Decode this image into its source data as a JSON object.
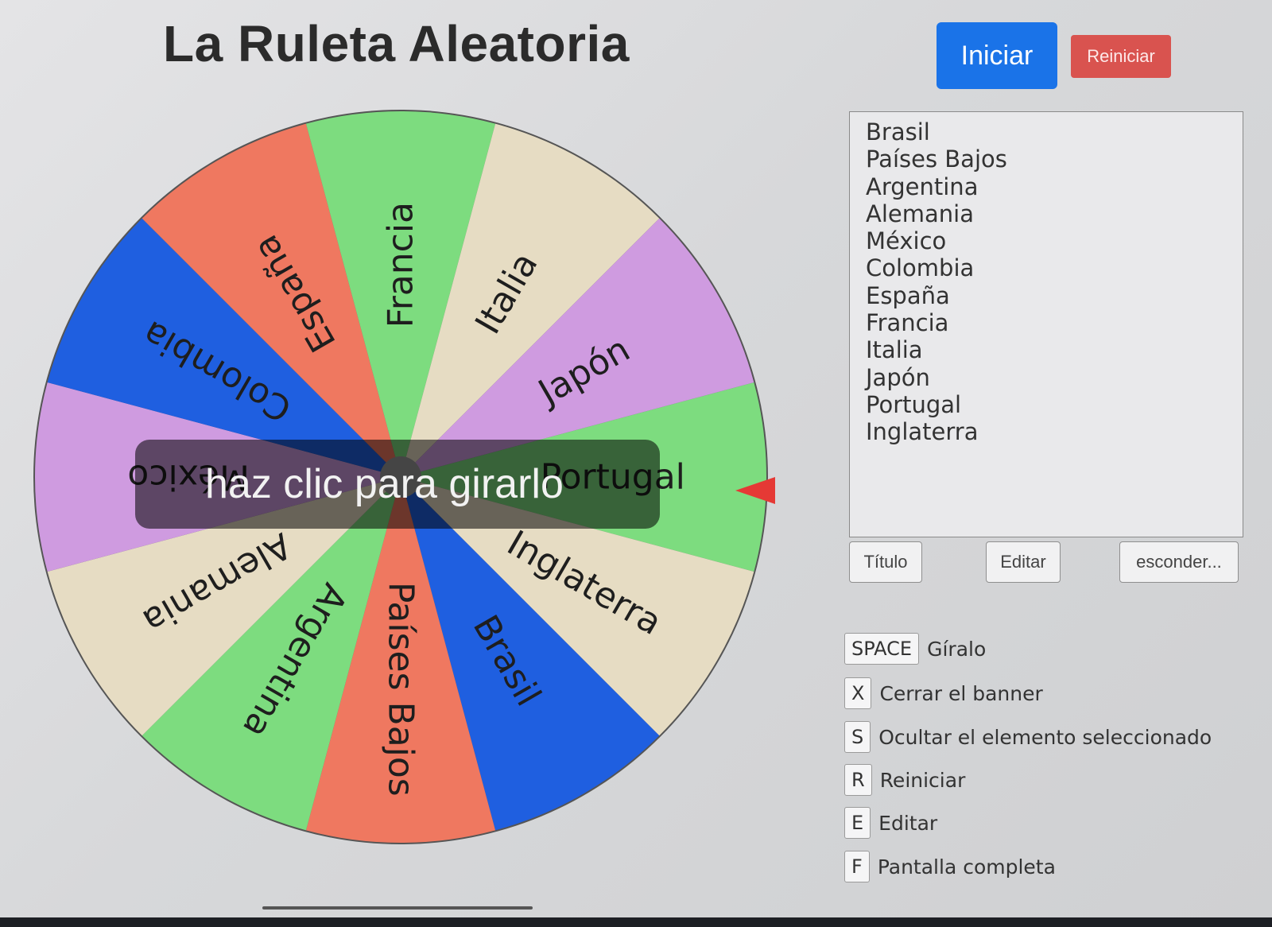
{
  "header": {
    "title": "La Ruleta Aleatoria",
    "start_label": "Iniciar",
    "reset_label": "Reiniciar",
    "start_color": "#1a73e8",
    "reset_color": "#d9534f"
  },
  "wheel": {
    "overlay_text": "haz clic para girarlo",
    "pointer_color": "#e53935",
    "segments": [
      {
        "label": "Portugal",
        "color": "#7ddc7f"
      },
      {
        "label": "Inglaterra",
        "color": "#e6dcc3"
      },
      {
        "label": "Brasil",
        "color": "#1f5fe0"
      },
      {
        "label": "Países Bajos",
        "color": "#ef7860"
      },
      {
        "label": "Argentina",
        "color": "#7ddc7f"
      },
      {
        "label": "Alemania",
        "color": "#e6dcc3"
      },
      {
        "label": "México",
        "color": "#cf9be0"
      },
      {
        "label": "Colombia",
        "color": "#1f5fe0"
      },
      {
        "label": "España",
        "color": "#ef7860"
      },
      {
        "label": "Francia",
        "color": "#7ddc7f"
      },
      {
        "label": "Italia",
        "color": "#e6dcc3"
      },
      {
        "label": "Japón",
        "color": "#cf9be0"
      }
    ]
  },
  "entries": {
    "items": [
      "Brasil",
      "Países Bajos",
      "Argentina",
      "Alemania",
      "México",
      "Colombia",
      "España",
      "Francia",
      "Italia",
      "Japón",
      "Portugal",
      "Inglaterra"
    ]
  },
  "controls": {
    "title_label": "Título",
    "edit_label": "Editar",
    "hide_label": "esconder..."
  },
  "shortcuts": [
    {
      "key": "SPACE",
      "label": "Gíralo"
    },
    {
      "key": "X",
      "label": "Cerrar el banner"
    },
    {
      "key": "S",
      "label": "Ocultar el elemento seleccionado"
    },
    {
      "key": "R",
      "label": "Reiniciar"
    },
    {
      "key": "E",
      "label": "Editar"
    },
    {
      "key": "F",
      "label": "Pantalla completa"
    }
  ]
}
